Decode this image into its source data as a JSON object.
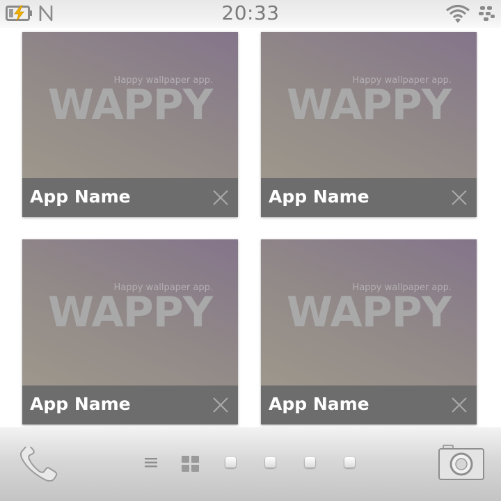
{
  "status_bar": {
    "time": "20:33",
    "battery_icon": "battery-charging-icon",
    "nfc_icon": "nfc-icon",
    "wifi_icon": "wifi-icon",
    "network_icon": "blackberry-icon"
  },
  "cards": [
    {
      "name": "App Name",
      "tagline": "Happy wallpaper app.",
      "logo_text": "WAPPY",
      "close_icon": "close-icon"
    },
    {
      "name": "App Name",
      "tagline": "Happy wallpaper app.",
      "logo_text": "WAPPY",
      "close_icon": "close-icon"
    },
    {
      "name": "App Name",
      "tagline": "Happy wallpaper app.",
      "logo_text": "WAPPY",
      "close_icon": "close-icon"
    },
    {
      "name": "App Name",
      "tagline": "Happy wallpaper app.",
      "logo_text": "WAPPY",
      "close_icon": "close-icon"
    }
  ],
  "dock": {
    "phone_icon": "phone-icon",
    "list_icon": "list-icon",
    "grid_icon": "grid-icon",
    "page_dots": 4,
    "camera_icon": "camera-icon"
  },
  "colors": {
    "card_footer": "#6d6d6d",
    "card_preview_start": "#9d978c",
    "card_preview_end": "#84758a",
    "logo_text": "#a9a9a9",
    "accent_battery_bolt": "#f2b300"
  }
}
